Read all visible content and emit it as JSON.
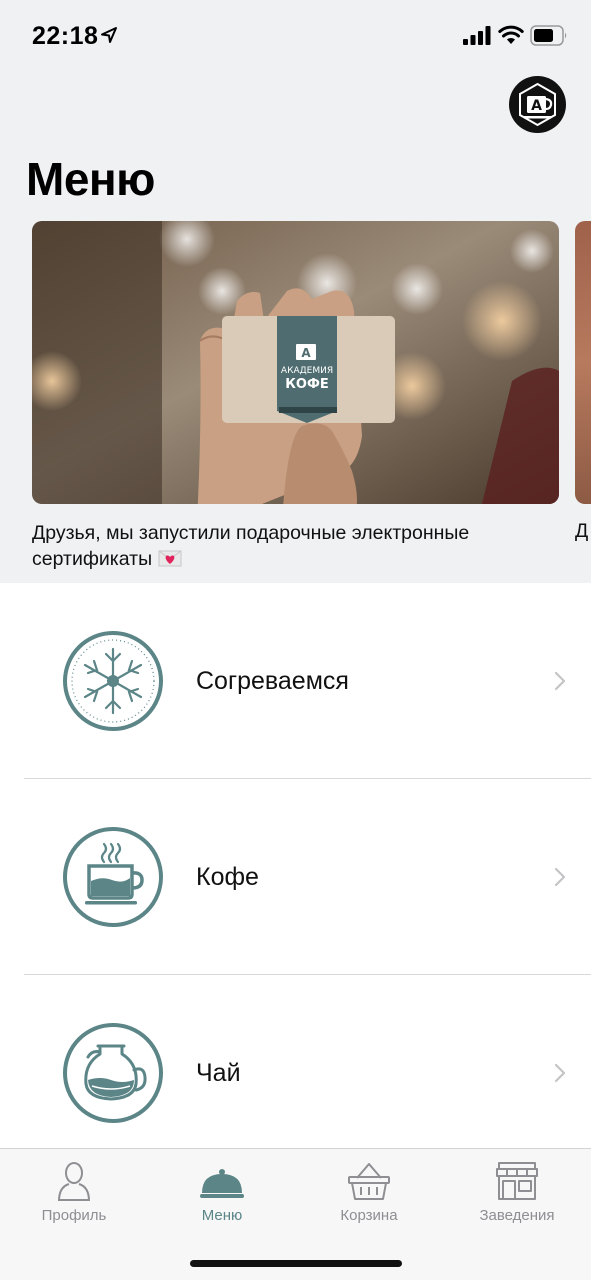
{
  "status_bar": {
    "time": "22:18",
    "icons": [
      "location-arrow-icon",
      "signal-icon",
      "wifi-icon",
      "battery-icon"
    ]
  },
  "header": {
    "title": "Меню",
    "logo_icon": "academy-coffee-logo-icon"
  },
  "banner": {
    "caption": "Друзья, мы запустили подарочные электронные сертификаты",
    "caption_emoji_icon": "love-letter-icon",
    "card_brand_line1": "АКАДЕМИЯ",
    "card_brand_line2": "КОФЕ",
    "next_caption_peek": "Д"
  },
  "categories": [
    {
      "label": "Согреваемся",
      "icon": "snowflake-icon"
    },
    {
      "label": "Кофе",
      "icon": "coffee-cup-icon"
    },
    {
      "label": "Чай",
      "icon": "teapot-icon"
    }
  ],
  "tab_bar": {
    "items": [
      {
        "label": "Профиль",
        "icon": "profile-icon",
        "active": false
      },
      {
        "label": "Меню",
        "icon": "cloche-icon",
        "active": true
      },
      {
        "label": "Корзина",
        "icon": "basket-icon",
        "active": false
      },
      {
        "label": "Заведения",
        "icon": "storefront-icon",
        "active": false
      }
    ]
  },
  "colors": {
    "accent": "#5b8587",
    "tab_inactive": "#8e8e93",
    "header_bg": "#eff1f3"
  }
}
